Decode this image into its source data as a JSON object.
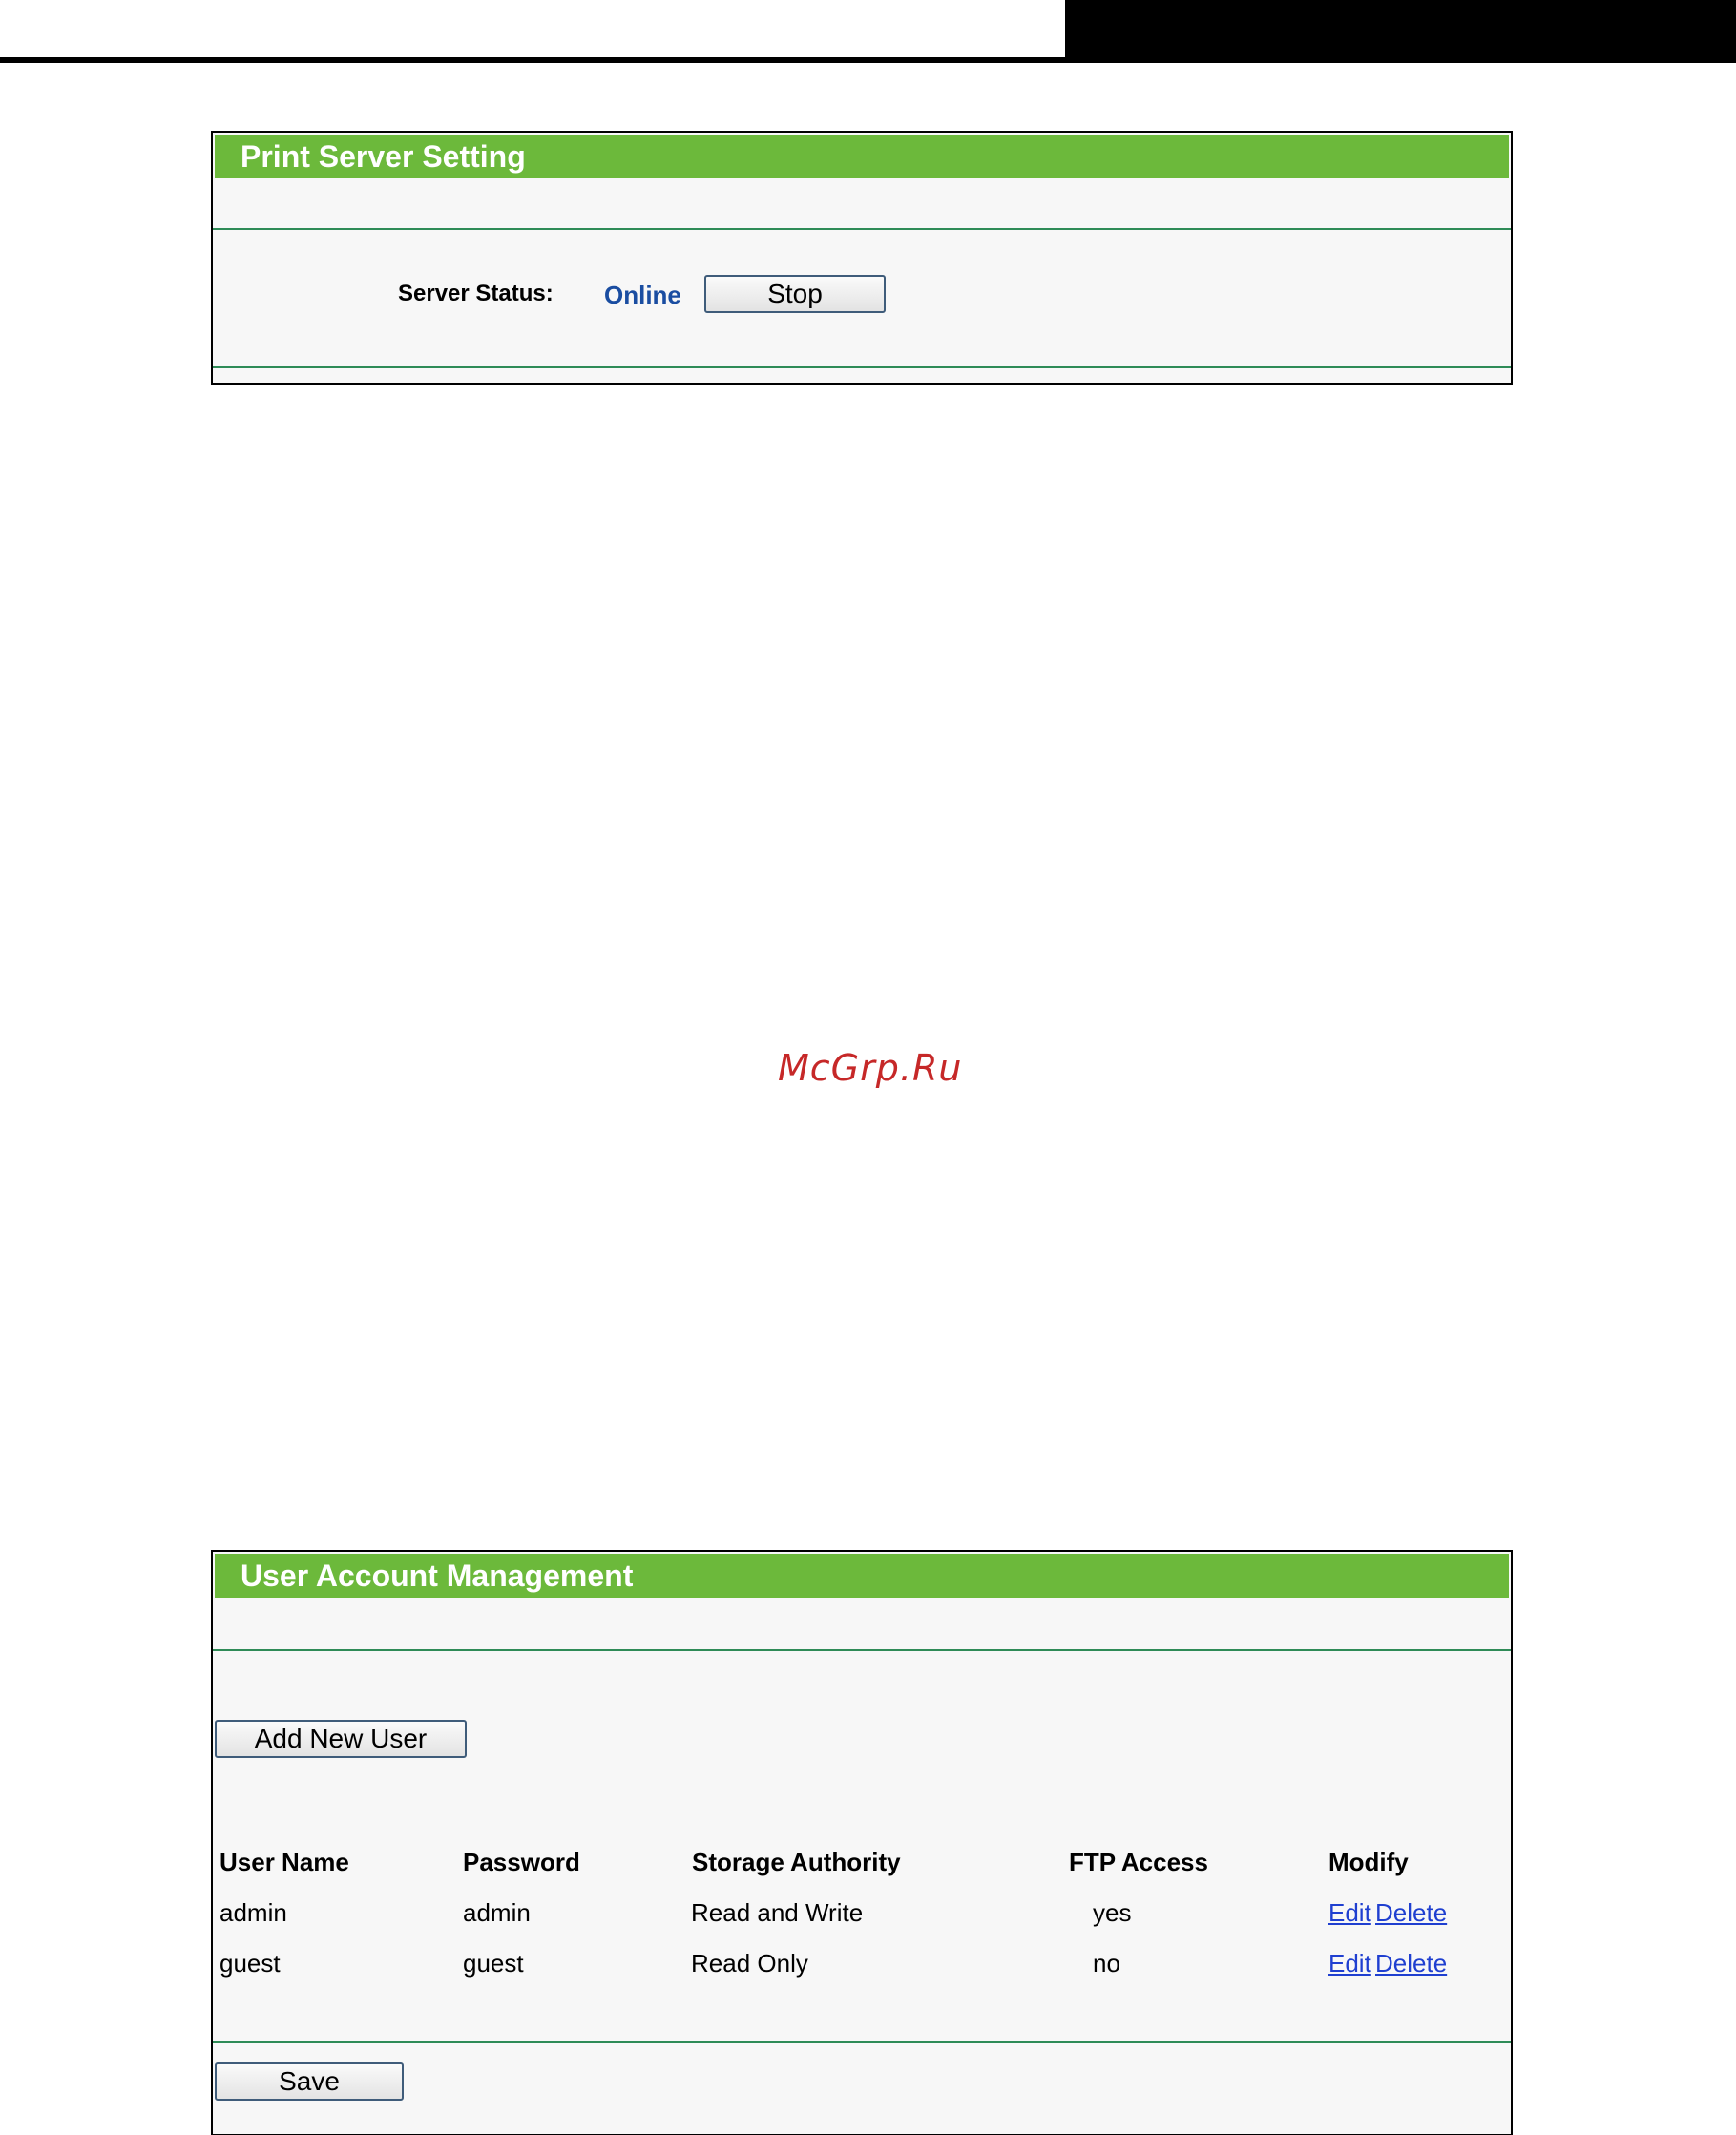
{
  "print_server": {
    "title": "Print Server Setting",
    "status_label": "Server Status:",
    "status_value": "Online",
    "stop_button": "Stop"
  },
  "watermark": "McGrp.Ru",
  "user_accounts": {
    "title": "User Account Management",
    "add_button": "Add New User",
    "columns": [
      "User Name",
      "Password",
      "Storage Authority",
      "FTP Access",
      "Modify"
    ],
    "rows": [
      {
        "user": "admin",
        "password": "admin",
        "authority": "Read and Write",
        "ftp": "yes",
        "edit": "Edit",
        "delete": "Delete"
      },
      {
        "user": "guest",
        "password": "guest",
        "authority": "Read Only",
        "ftp": "no",
        "edit": "Edit",
        "delete": "Delete"
      }
    ],
    "save_button": "Save"
  },
  "colors": {
    "header_green": "#6cb93b",
    "rule_green": "#2e8b57",
    "status_blue": "#1a4da1",
    "link_blue": "#1f3fd0",
    "watermark_red": "#c62828"
  }
}
